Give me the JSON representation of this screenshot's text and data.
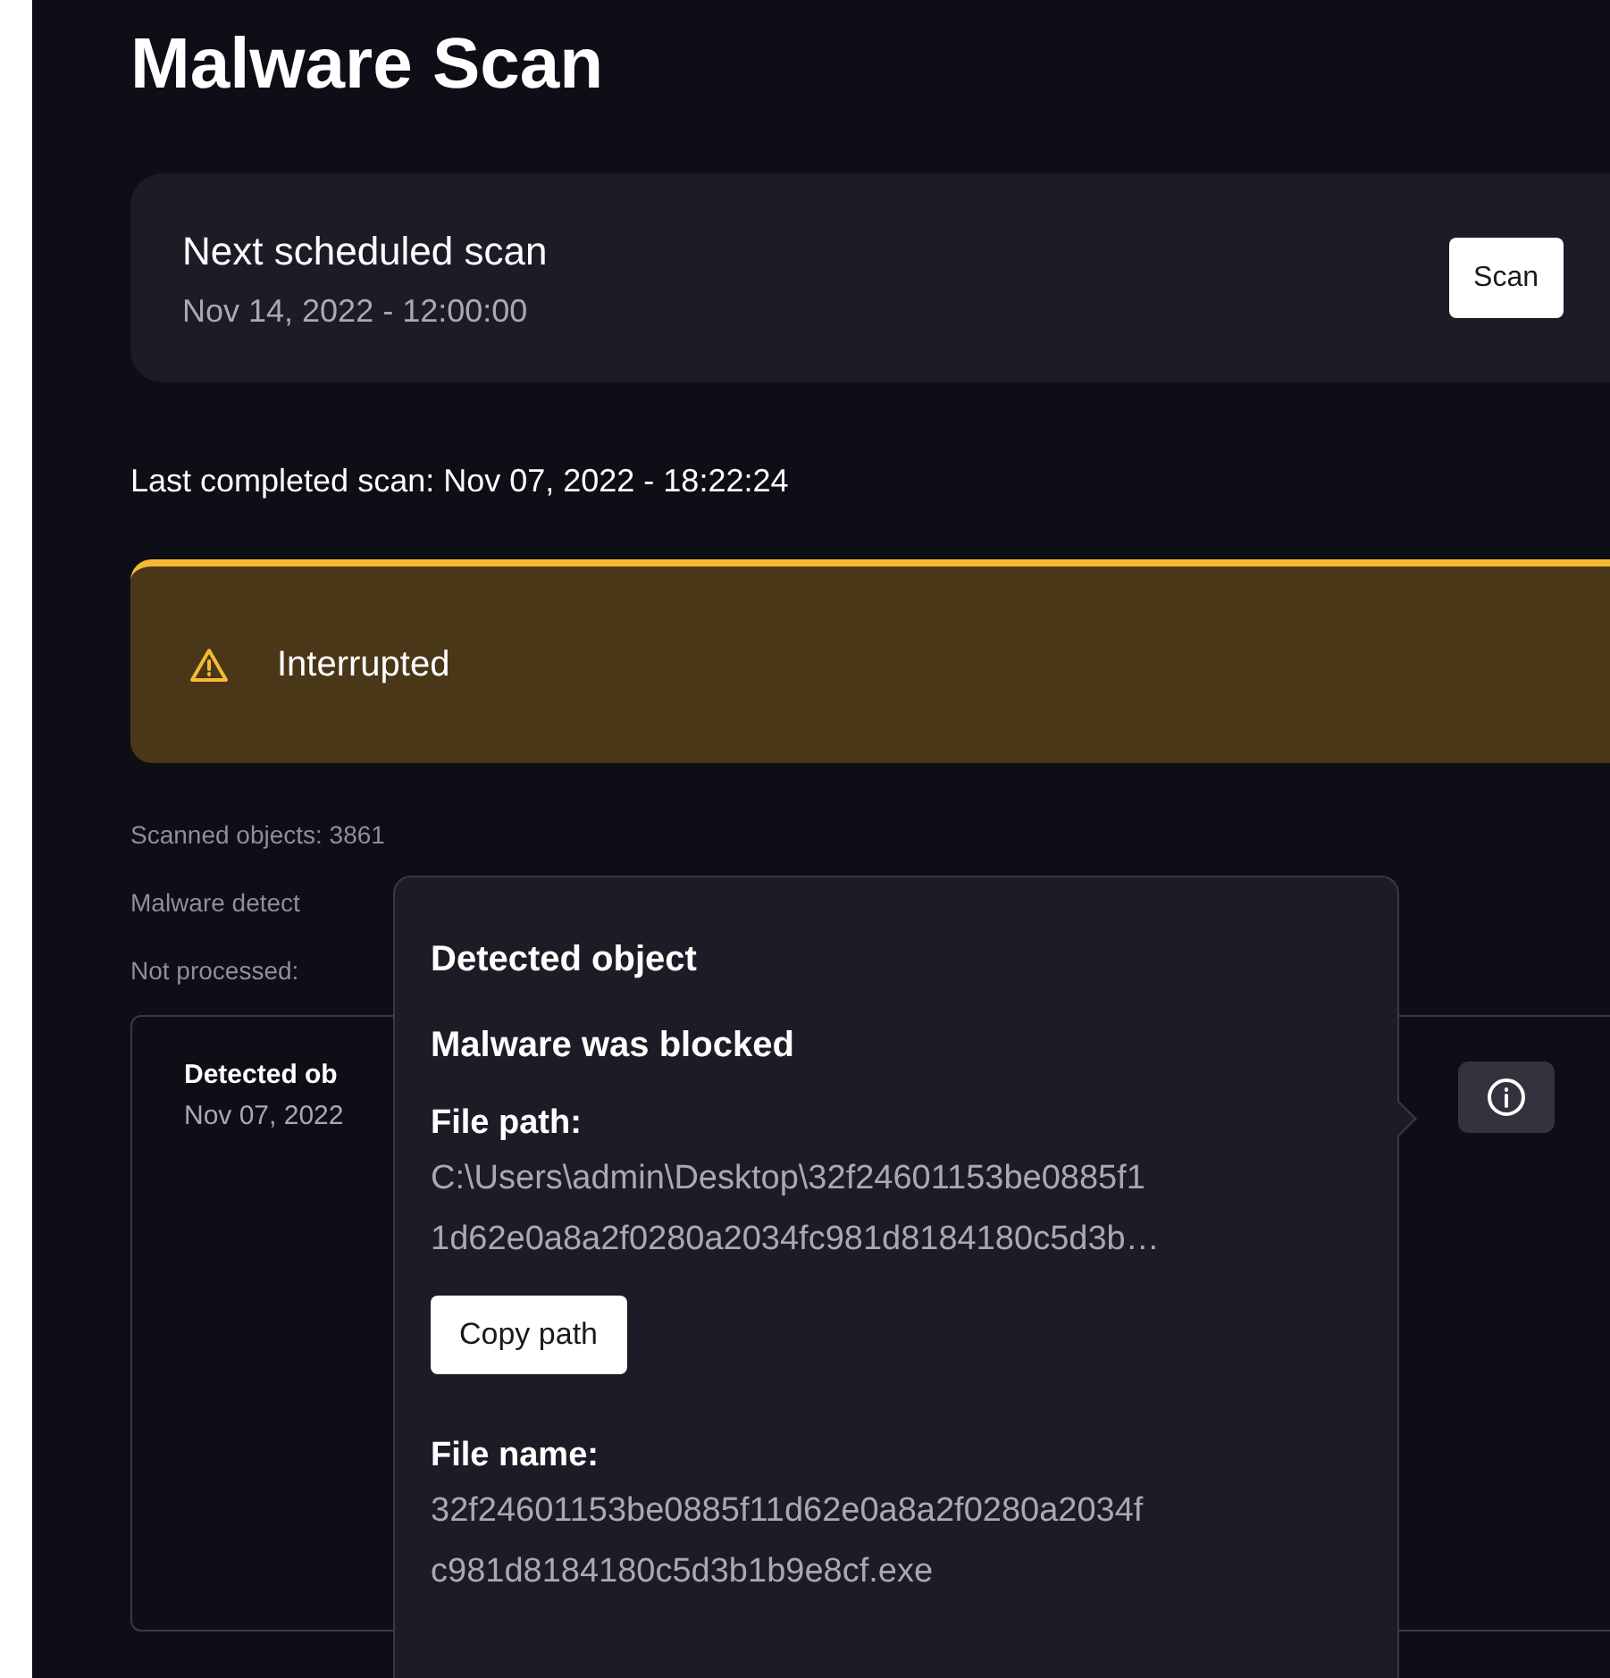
{
  "title": "Malware Scan",
  "schedule": {
    "label": "Next scheduled scan",
    "date": "Nov 14, 2022 - 12:00:00",
    "button": "Scan"
  },
  "last_scan": "Last completed scan: Nov 07, 2022 - 18:22:24",
  "status": {
    "kind": "warning",
    "label": "Interrupted"
  },
  "stats": [
    "Scanned objects: 3861",
    "Malware detect",
    "Not processed:"
  ],
  "detection": {
    "title": "Detected ob",
    "date": "Nov 07, 2022"
  },
  "popover": {
    "title": "Detected object",
    "subtitle": "Malware was blocked",
    "path_label": "File path:",
    "path_lines": [
      "C:\\Users\\admin\\Desktop\\32f24601153be0885f1",
      "1d62e0a8a2f0280a2034fc981d8184180c5d3b…"
    ],
    "copy_button": "Copy path",
    "name_label": "File name:",
    "name_lines": [
      "32f24601153be0885f11d62e0a8a2f0280a2034f",
      "c981d8184180c5d3b1b9e8cf.exe"
    ]
  }
}
